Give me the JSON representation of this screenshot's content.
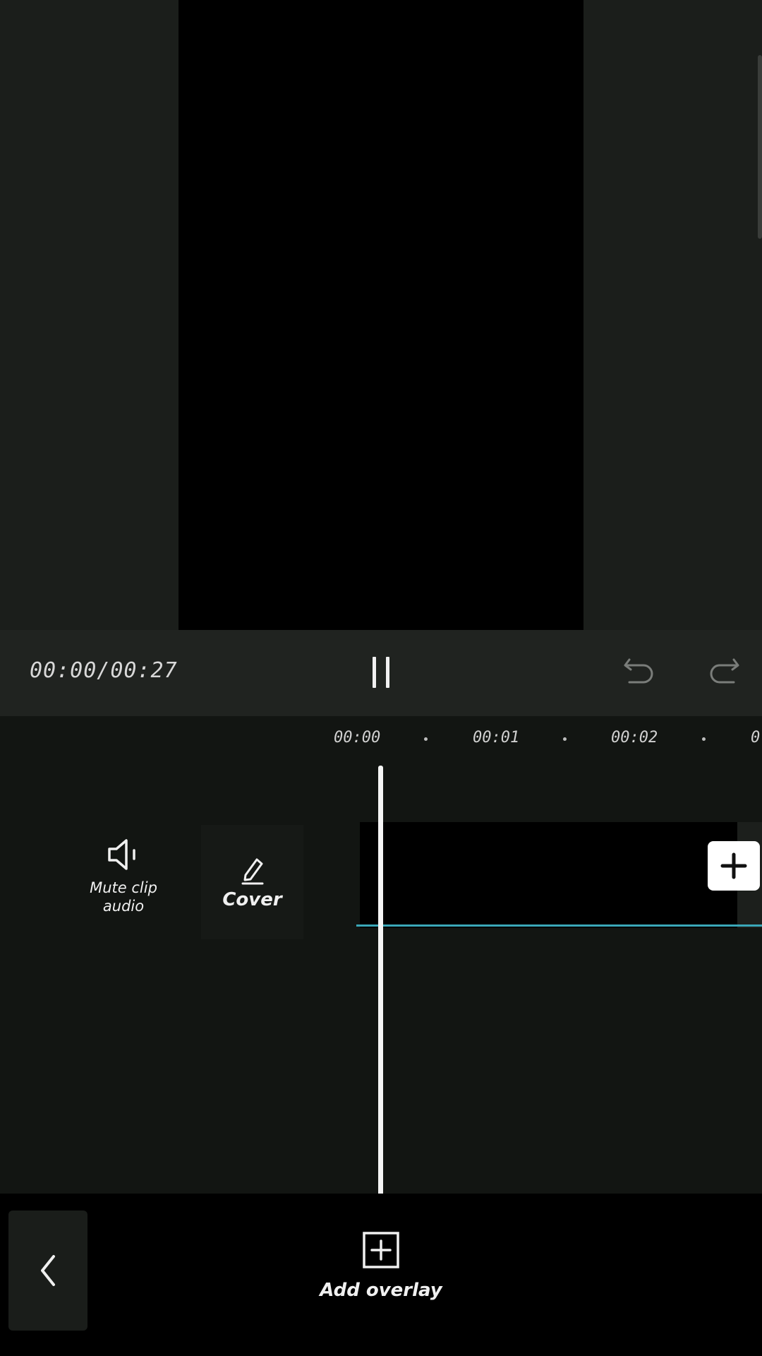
{
  "playback": {
    "timecode": "00:00/00:27"
  },
  "timeline": {
    "ticks": [
      "00:00",
      "00:01",
      "00:02",
      "0"
    ]
  },
  "tools": {
    "mute_label": "Mute clip audio",
    "cover_label": "Cover"
  },
  "bottom": {
    "add_overlay_label": "Add overlay"
  },
  "icons": {
    "pause": "pause-icon",
    "undo": "undo-icon",
    "redo": "redo-icon",
    "speaker": "speaker-icon",
    "pencil": "pencil-icon",
    "plus": "plus-icon",
    "back": "chevron-left-icon",
    "add_overlay": "add-box-icon"
  },
  "colors": {
    "accent": "#3aa7b8",
    "background": "#171a17"
  }
}
